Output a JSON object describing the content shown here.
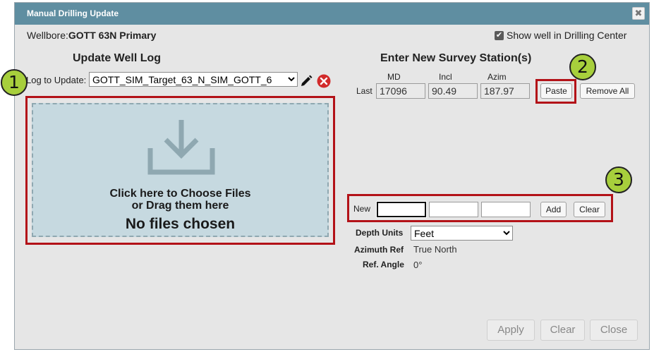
{
  "dialog": {
    "title": "Manual Drilling Update",
    "close_glyph": "✖"
  },
  "wellbore": {
    "label": "Wellbore:",
    "name": "GOTT 63N Primary"
  },
  "show_well": {
    "label": "Show well in Drilling Center",
    "checked": true
  },
  "update_log": {
    "heading": "Update Well Log",
    "log_label": "Log to Update:",
    "log_value": "GOTT_SIM_Target_63_N_SIM_GOTT_6"
  },
  "dropzone": {
    "line1": "Click here to Choose Files",
    "line2": "or Drag them here",
    "status": "No files chosen"
  },
  "survey": {
    "heading": "Enter New Survey Station(s)",
    "columns": [
      "MD",
      "Incl",
      "Azim"
    ],
    "last_label": "Last",
    "last_values": [
      "17096",
      "90.49",
      "187.97"
    ],
    "paste_label": "Paste",
    "remove_all_label": "Remove All",
    "new_label": "New",
    "add_label": "Add",
    "clear_label": "Clear"
  },
  "settings": {
    "depth_units_label": "Depth Units",
    "depth_units_value": "Feet",
    "azimuth_ref_label": "Azimuth Ref",
    "azimuth_ref_value": "True North",
    "ref_angle_label": "Ref. Angle",
    "ref_angle_value": "0°"
  },
  "footer": {
    "apply": "Apply",
    "clear": "Clear",
    "close": "Close"
  },
  "callouts": [
    "1",
    "2",
    "3"
  ],
  "colors": {
    "titlebar": "#5f8ea1",
    "highlight": "#b31218",
    "callout": "#a7cf3c",
    "dropzone": "#c6d9e0"
  }
}
